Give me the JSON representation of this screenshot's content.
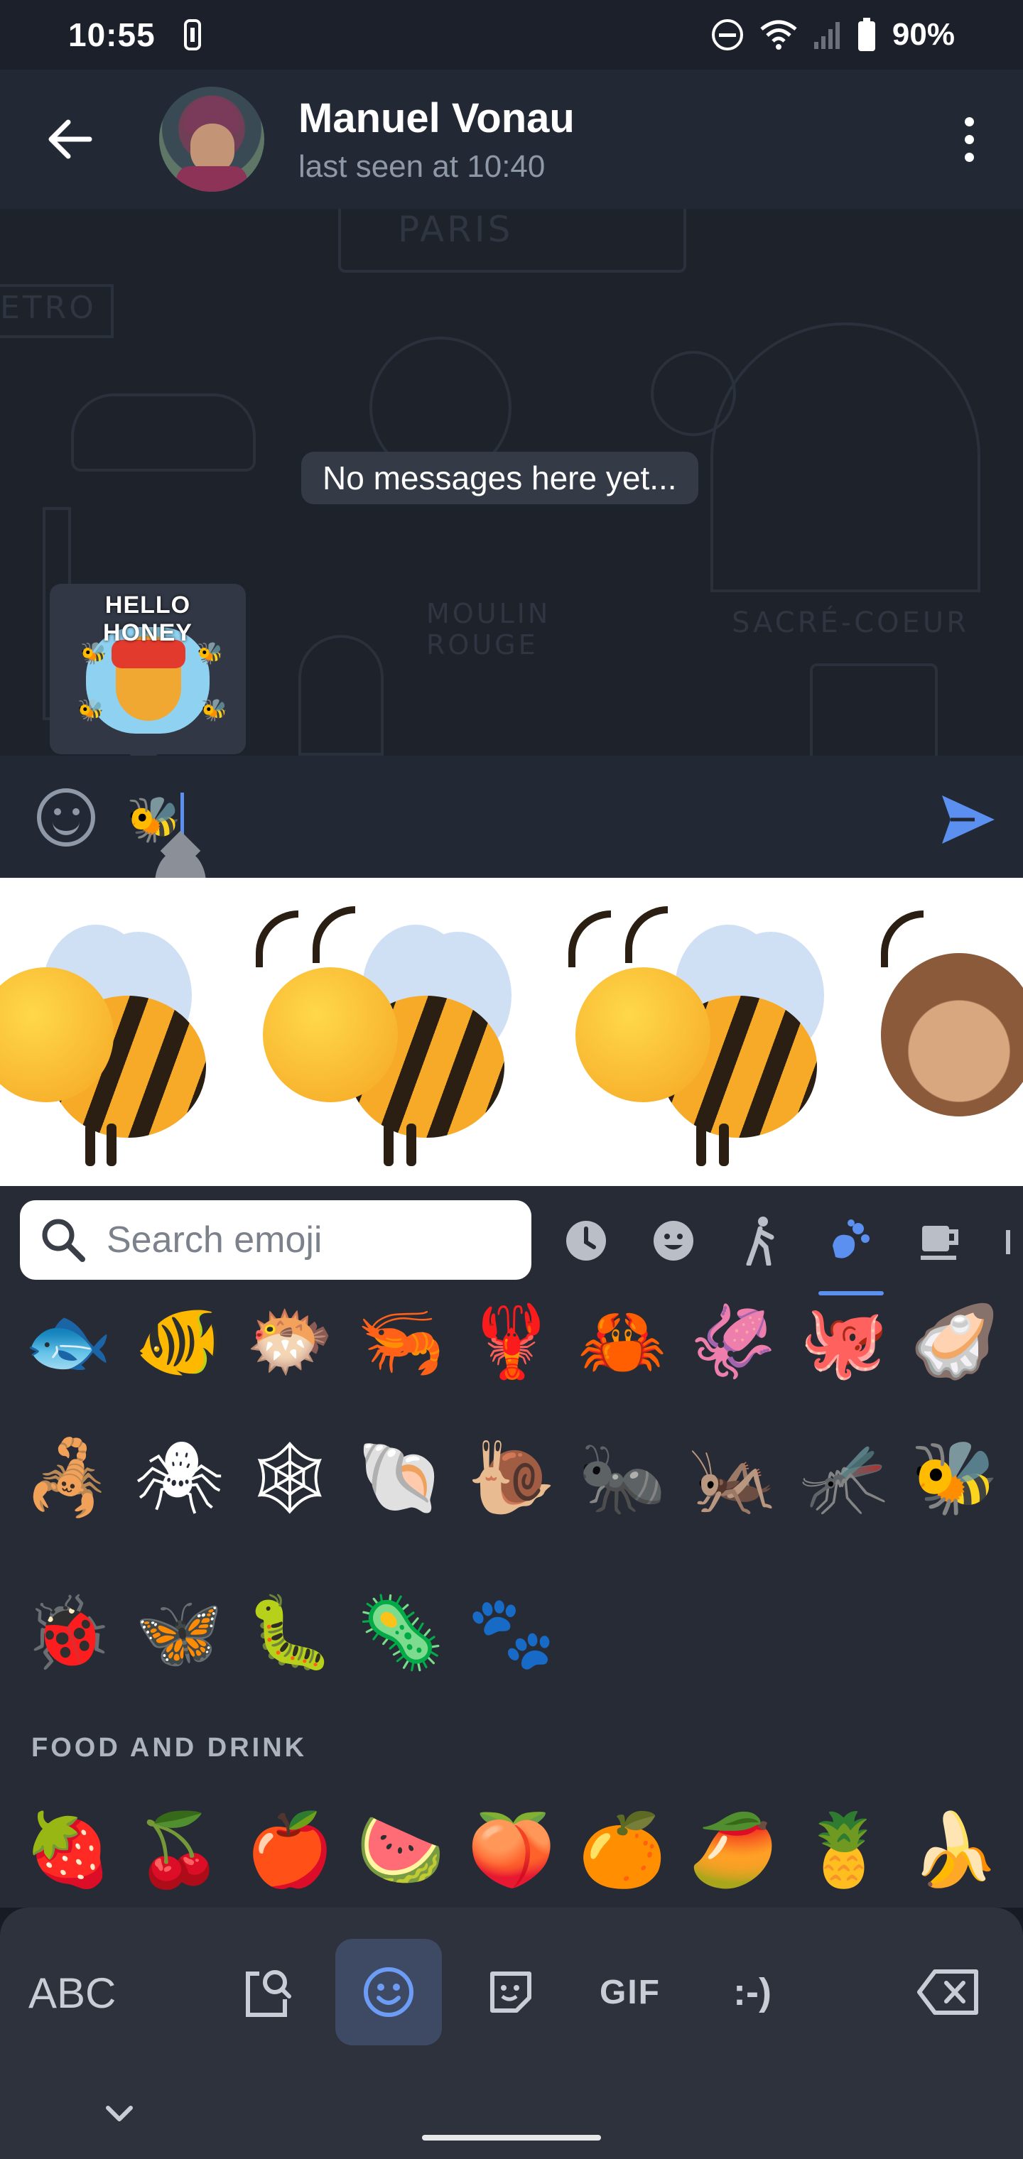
{
  "status_bar": {
    "time": "10:55",
    "battery": "90%"
  },
  "header": {
    "contact_name": "Manuel Vonau",
    "last_seen": "last seen at 10:40"
  },
  "chat": {
    "empty_text": "No messages here yet...",
    "wallpaper_text": [
      "PARIS",
      "ETRO",
      "MOULIN",
      "ROUGE",
      "SACRÉ-COEUR"
    ],
    "sticker_suggestion": {
      "caption": "HELLO HONEY"
    }
  },
  "composer": {
    "input_value": "🐝"
  },
  "emoji_search": {
    "placeholder": "Search emoji"
  },
  "emoji_categories": [
    "recent-icon",
    "smileys-icon",
    "people-icon",
    "animals-nature-icon",
    "food-icon",
    "more-icon"
  ],
  "emoji_rows": [
    [
      "🐟",
      "🐠",
      "🐡",
      "🦐",
      "🦞",
      "🦀",
      "🦑",
      "🐙",
      "🦪"
    ],
    [
      "🦂",
      "🕷",
      "🕸",
      "🐚",
      "🐌",
      "🐜",
      "🦗",
      "🦟",
      "🐝"
    ],
    [
      "🐞",
      "🦋",
      "🐛",
      "🦠",
      "🐾"
    ]
  ],
  "section_label": "FOOD AND DRINK",
  "food_row": [
    "🍓",
    "🍒",
    "🍎",
    "🍉",
    "🍑",
    "🍊",
    "🥭",
    "🍍",
    "🍌"
  ],
  "keyboard": {
    "abc_label": "ABC",
    "gif_label": "GIF",
    "emoticon_label": ":-)"
  },
  "colors": {
    "accent": "#5b8ff0",
    "header_bg": "#222834",
    "chat_bg": "#1e222b",
    "panel_bg": "#262b36"
  }
}
